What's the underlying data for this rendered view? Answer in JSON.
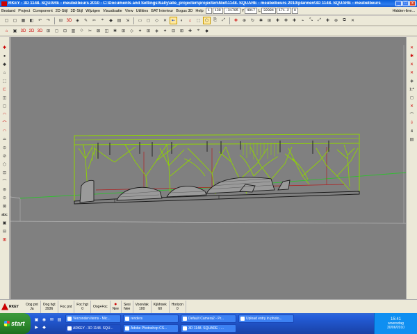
{
  "window": {
    "title": "RKEY - 3D 1148. SQUARE - meubelbeurs 2010 - C:\\Documents and Settings\\Sally\\alle_projecten\\projecten\\Niet\\1148. SQUARE - meubelbeurs 2010\\plannen\\3D 1148. SQUARE - meubelbeurs",
    "btn_min": "_",
    "btn_max": "□",
    "btn_close": "x"
  },
  "menu": {
    "items": [
      "Bestand",
      "Project",
      "Component",
      "2D-Stijl",
      "3D-Stijl",
      "Wijzigen",
      "Visualisatie",
      "View",
      "Utilities",
      "BAT Interieur",
      "Bogus 3D",
      "Help"
    ],
    "coord_1": "1",
    "coord_2": "139",
    "coord_3": "-31705",
    "coord_y_label": "Y",
    "coord_y": "4917",
    "coord_l_label": "L",
    "coord_l": "32084",
    "coord_4": "171.2",
    "coord_5": "0",
    "hidden_line": "Hidden-line..."
  },
  "toolbar1": [
    "▢",
    "▢",
    "▦",
    "◧",
    "↶",
    "↷",
    "⊟",
    "3D",
    "◈",
    "✎",
    "✂",
    "⌖",
    "◆",
    "▤",
    "⇲",
    "▭",
    "◻",
    "◇",
    "✕",
    "⇤",
    "◐",
    "⌂",
    "⬚",
    "⬡",
    "⎘",
    "⤢",
    "✚",
    "⊕",
    "↻",
    "✱",
    "⊞",
    "✚",
    "✚",
    "✚",
    "⌁",
    "⤡",
    "⤢",
    "✚",
    "⊕",
    "⧉",
    "✕"
  ],
  "toolbar2": [
    "⌂",
    "▣",
    "3D",
    "2D",
    "3D",
    "⊞",
    "◻",
    "⊡",
    "▥",
    "⬦",
    "✂",
    "⊠",
    "◫",
    "✱",
    "⊞",
    "◇",
    "✦",
    "⊞",
    "◈",
    "✦",
    "⊟",
    "⊞",
    "✚",
    "⌖",
    "◆"
  ],
  "left_tools": [
    "✱",
    "●",
    "◆",
    "⌂",
    "⬚",
    "⊏",
    "◫",
    "◻",
    "◠",
    "⌒",
    "◠",
    "⌓",
    "⊙",
    "⊘",
    "⬡",
    "⊡",
    "⌒",
    "⊚",
    "⊙",
    "⊠",
    "abc",
    "▣",
    "⊟",
    "⊞"
  ],
  "right_tools": [
    "✕",
    "✱",
    "✕",
    "✕",
    "◈",
    "1:*",
    "◻",
    "✕",
    "⌒",
    "⇩",
    "4",
    "▤"
  ],
  "statusbar": {
    "logo_text": "RKEY",
    "cells": [
      {
        "label": "Oog pnt",
        "value": "Ja"
      },
      {
        "label": "Oog hgt",
        "value": "3936"
      },
      {
        "label": "Foc pnt",
        "value": ""
      },
      {
        "label": "Foc hgt",
        "value": "0"
      },
      {
        "label": "Oog+Foc",
        "value": ""
      },
      {
        "label": "Nee",
        "value": ""
      },
      {
        "label": "Sesi",
        "value": "Nee"
      },
      {
        "label": "Voorvlak",
        "value": "100"
      },
      {
        "label": "Kijkhoek",
        "value": "60"
      },
      {
        "label": "Horizon",
        "value": "0"
      }
    ]
  },
  "taskbar": {
    "start": "start",
    "tasks": [
      "Verzonden items - Mic...",
      "renders",
      "Default Camera2 - Pr...",
      "Upload entry in photo...",
      "ARKEY - 3D 1148. SQU...",
      "Adobe Photoshop CS...",
      "3D 1148. SQUARE - ...",
      ""
    ],
    "time": "15:41",
    "day": "woensdag",
    "date": "30/06/2010"
  },
  "colors": {
    "viewport_bg": "#808080",
    "wire_green": "#8fd400",
    "wire_dark": "#1a1a1a",
    "wire_red": "#b02020",
    "horizon": "#2ec02e"
  }
}
